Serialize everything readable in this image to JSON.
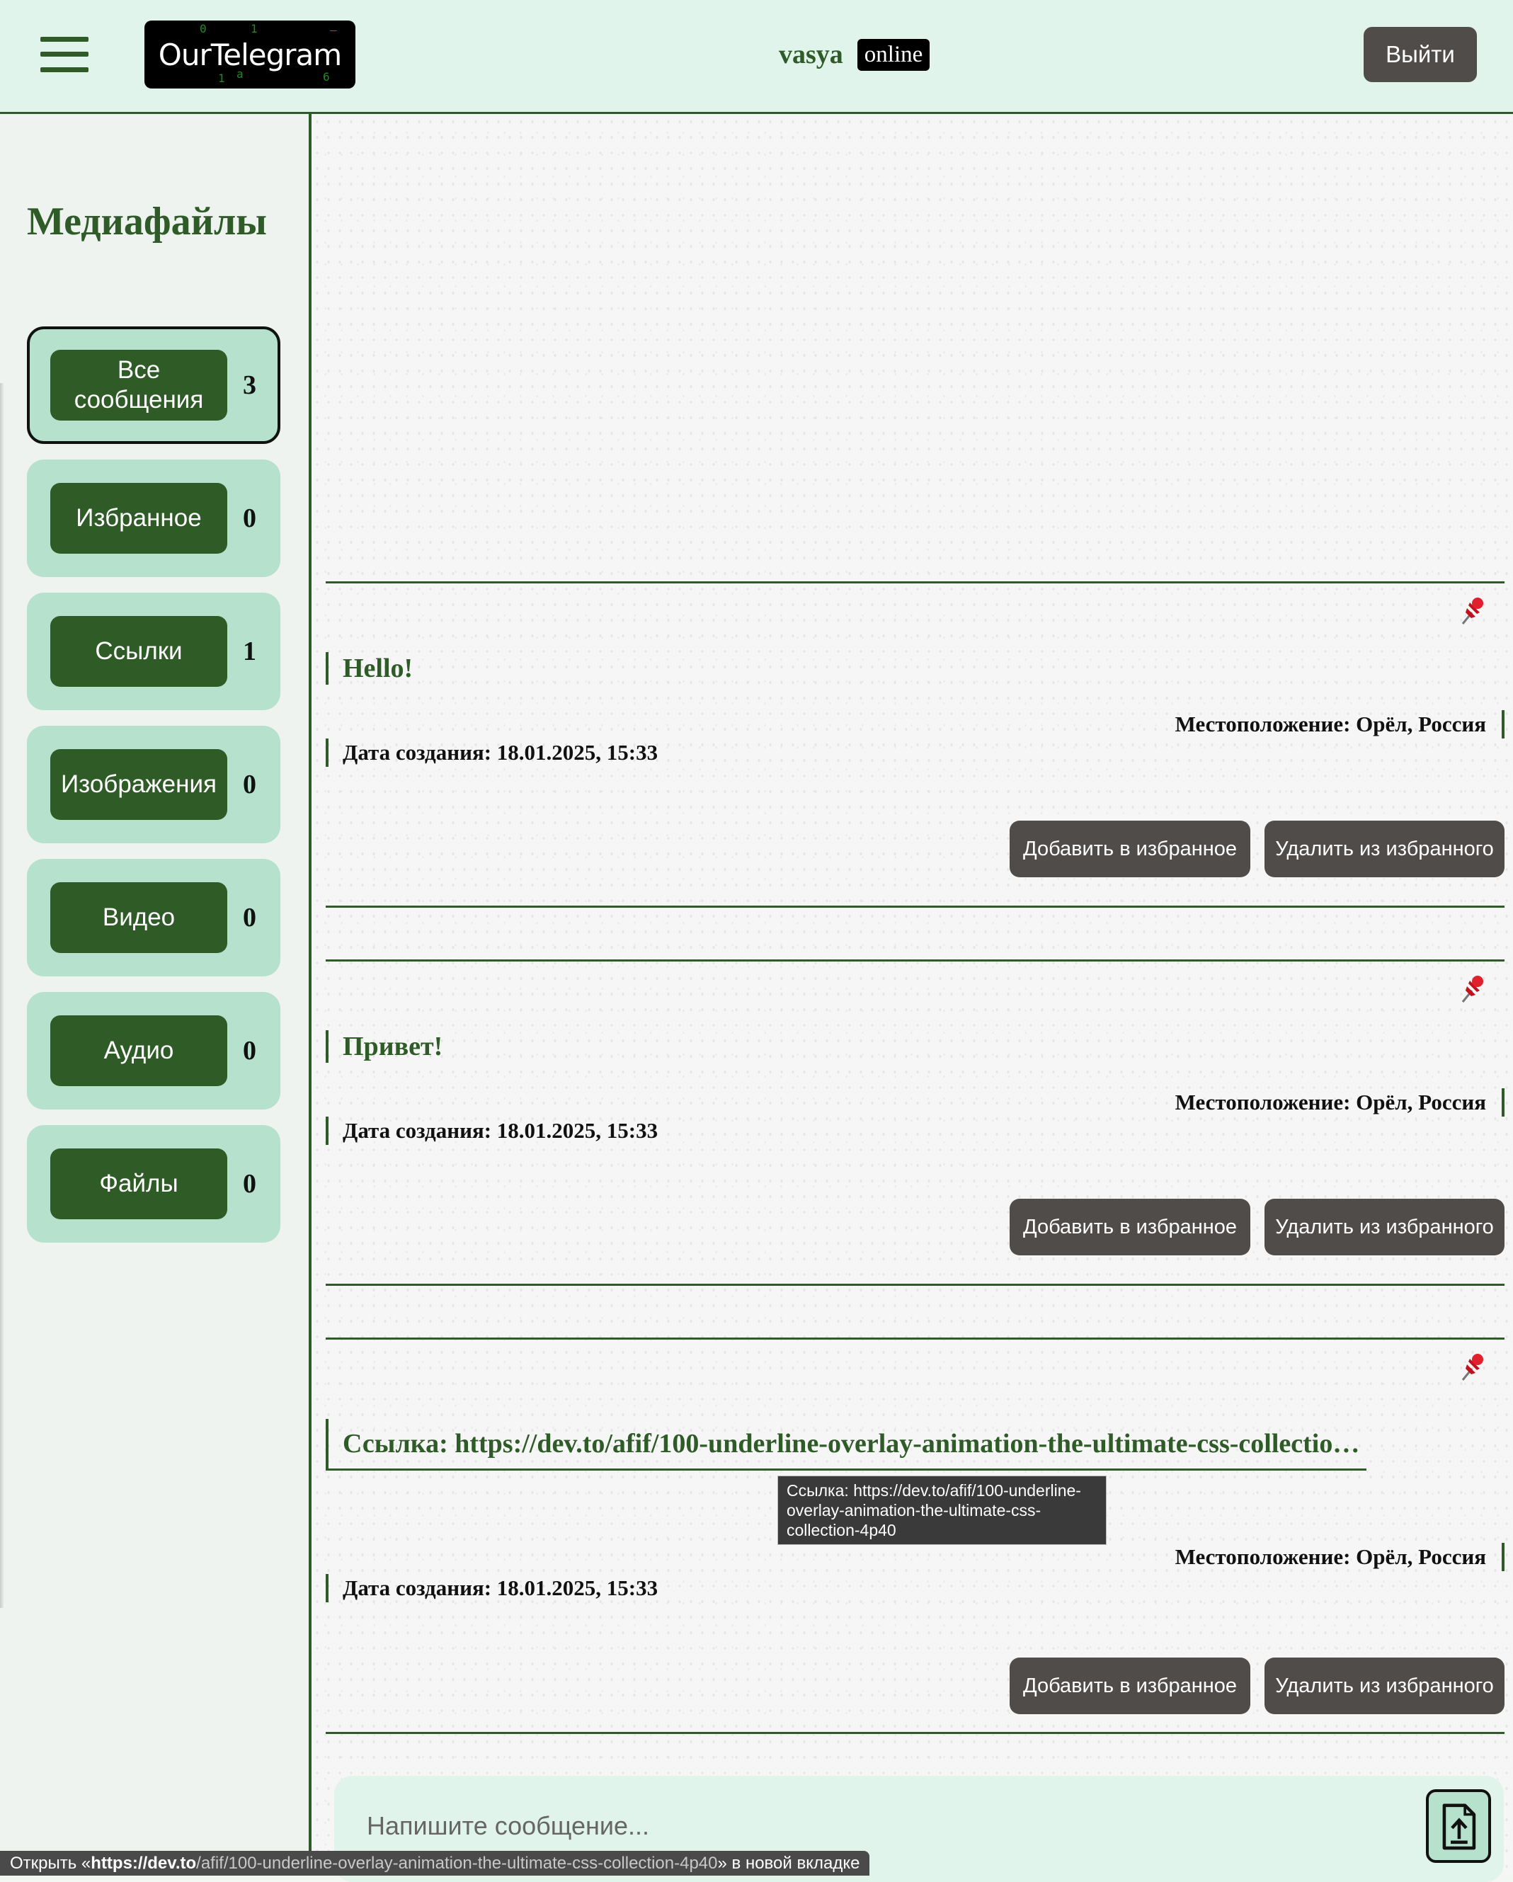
{
  "header": {
    "logo_text": "OurTelegram",
    "username": "vasya",
    "status": "online",
    "logout_label": "Выйти"
  },
  "sidebar": {
    "title": "Медиафайлы",
    "items": [
      {
        "label": "Все сообщения",
        "count": "3"
      },
      {
        "label": "Избранное",
        "count": "0"
      },
      {
        "label": "Ссылки",
        "count": "1"
      },
      {
        "label": "Изображения",
        "count": "0"
      },
      {
        "label": "Видео",
        "count": "0"
      },
      {
        "label": "Аудио",
        "count": "0"
      },
      {
        "label": "Файлы",
        "count": "0"
      }
    ]
  },
  "messages": [
    {
      "text": "Hello!",
      "location": "Местоположение: Орёл, Россия",
      "date": "Дата создания: 18.01.2025, 15:33",
      "add_fav": "Добавить в избранное",
      "remove_fav": "Удалить из избранного"
    },
    {
      "text": "Привет!",
      "location": "Местоположение: Орёл, Россия",
      "date": "Дата создания: 18.01.2025, 15:33",
      "add_fav": "Добавить в избранное",
      "remove_fav": "Удалить из избранного"
    },
    {
      "text": "Ссылка: https://dev.to/afif/100-underline-overlay-animation-the-ultimate-css-collection-4p40",
      "location": "Местоположение: Орёл, Россия",
      "date": "Дата создания: 18.01.2025, 15:33",
      "add_fav": "Добавить в избранное",
      "remove_fav": "Удалить из избранного"
    }
  ],
  "tooltip": "Ссылка: https://dev.to/afif/100-underline-overlay-animation-the-ultimate-css-collection-4p40",
  "composer": {
    "placeholder": "Напишите сообщение..."
  },
  "statusbar": {
    "prefix": "Открыть «",
    "host": "https://dev.to",
    "path": "/afif/100-underline-overlay-animation-the-ultimate-css-collection-4p40",
    "suffix": "» в новой вкладке"
  },
  "colors": {
    "accent": "#2e5b27",
    "header_bg": "#e1f4ec",
    "card_bg": "#b6e2cd",
    "button_dark": "#504c4a"
  },
  "icons": [
    "menu-icon",
    "pin-icon",
    "upload-file-icon"
  ]
}
